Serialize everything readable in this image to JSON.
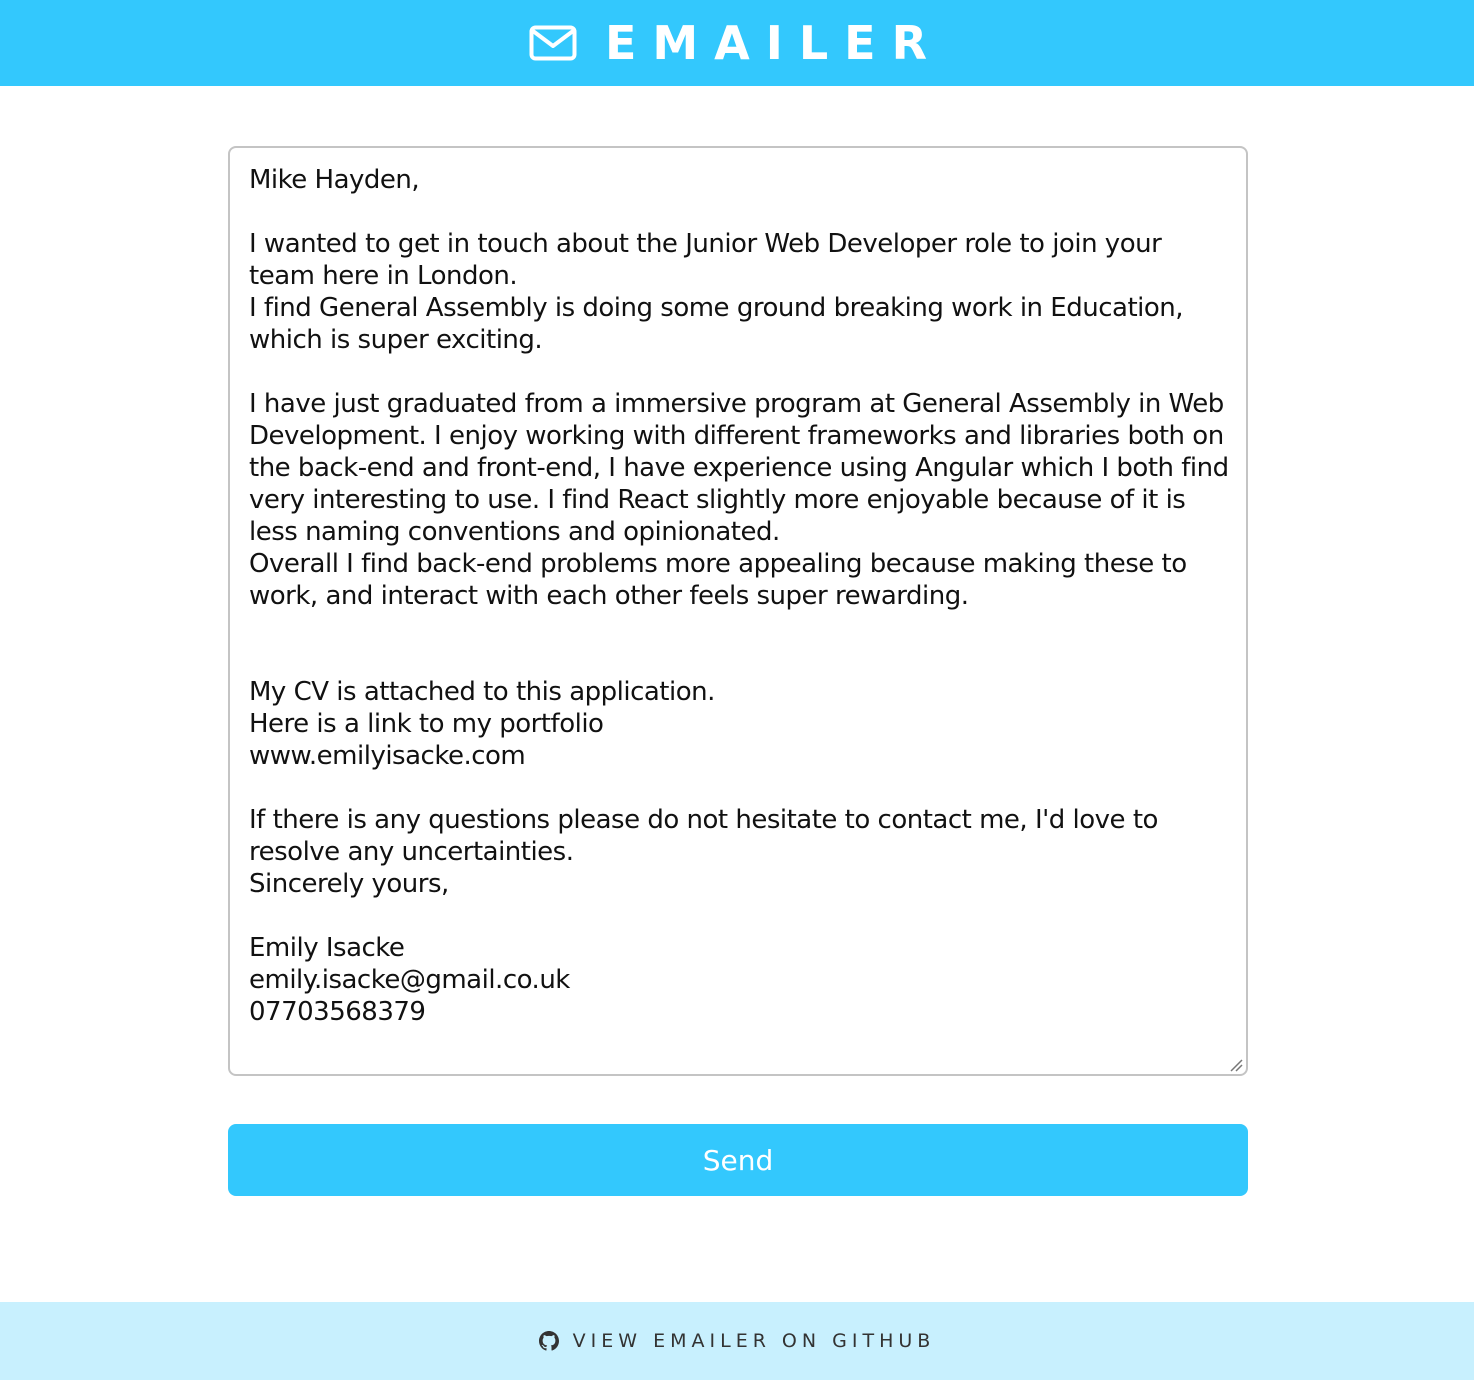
{
  "header": {
    "title": "EMAILER",
    "icon": "envelope-icon"
  },
  "email": {
    "body": "Mike Hayden,\n\nI wanted to get in touch about the Junior Web Developer role to join your team here in London.\nI find General Assembly is doing some ground breaking work in Education, which is super exciting.\n\nI have just graduated from a immersive program at General Assembly in Web Development. I enjoy working with different frameworks and libraries both on the back-end and front-end, I have experience using Angular which I both find very interesting to use. I find React slightly more enjoyable because of it is less naming conventions and opinionated.\nOverall I find back-end problems more appealing because making these to work, and interact with each other feels super rewarding.\n\n\nMy CV is attached to this application.\nHere is a link to my portfolio\nwww.emilyisacke.com\n\nIf there is any questions please do not hesitate to contact me, I'd love to resolve any uncertainties.\nSincerely yours,\n\nEmily Isacke\nemily.isacke@gmail.co.uk\n07703568379"
  },
  "send": {
    "label": "Send"
  },
  "footer": {
    "link_label": "VIEW EMAILER ON GITHUB",
    "icon": "github-icon"
  },
  "colors": {
    "accent": "#33c8fd",
    "footer_bg": "#c8f0fe",
    "text": "#111111"
  }
}
